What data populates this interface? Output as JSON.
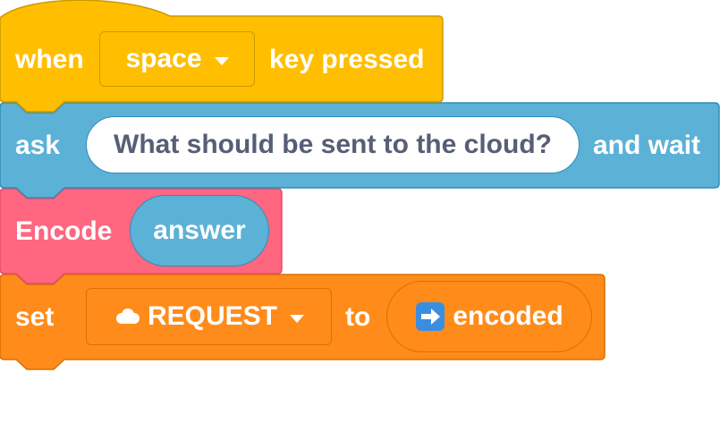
{
  "hat_block": {
    "prefix": "when",
    "key_dropdown": "space",
    "suffix": "key pressed",
    "color": "#FFBF00"
  },
  "ask_block": {
    "prefix": "ask",
    "question": "What should be sent to the cloud?",
    "suffix": "and wait",
    "color": "#5CB1D6"
  },
  "encode_block": {
    "label": "Encode",
    "reporter": "answer",
    "color": "#FF6680"
  },
  "set_block": {
    "prefix": "set",
    "variable_icon": "cloud-icon",
    "variable": "REQUEST",
    "middle": "to",
    "value_icon": "right-arrow-emoji-icon",
    "value": "encoded",
    "color": "#FF8C1A"
  }
}
